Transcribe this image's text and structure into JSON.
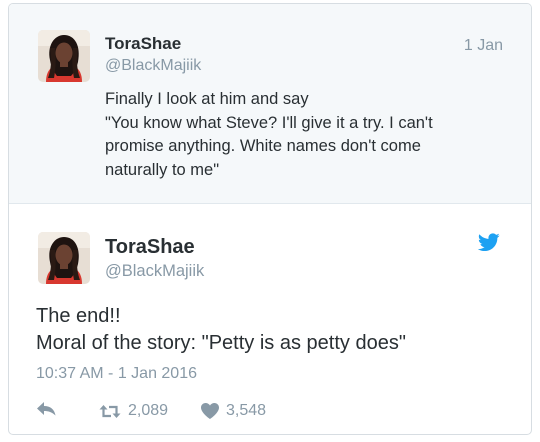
{
  "reply_tweet": {
    "display_name": "ToraShae",
    "handle": "@BlackMajiik",
    "date": "1 Jan",
    "text_lines": [
      "Finally I look at him and say",
      "\"You know what Steve? I'll give it a try. I can't",
      "promise  anything. White names don't come",
      "naturally to me\""
    ]
  },
  "main_tweet": {
    "display_name": "ToraShae",
    "handle": "@BlackMajiik",
    "text_lines": [
      "The end!!",
      "Moral of the story: \"Petty is as petty does\""
    ],
    "timestamp": "10:37 AM - 1 Jan 2016",
    "retweets": "2,089",
    "likes": "3,548"
  },
  "icons": {
    "brand": "twitter-bird-icon",
    "reply": "reply-arrow-icon",
    "retweet": "retweet-icon",
    "like": "heart-icon"
  },
  "colors": {
    "twitter_blue": "#1da1f2",
    "muted": "#8899a6",
    "text": "#292f33",
    "reply_bg": "#f5f8fa"
  }
}
